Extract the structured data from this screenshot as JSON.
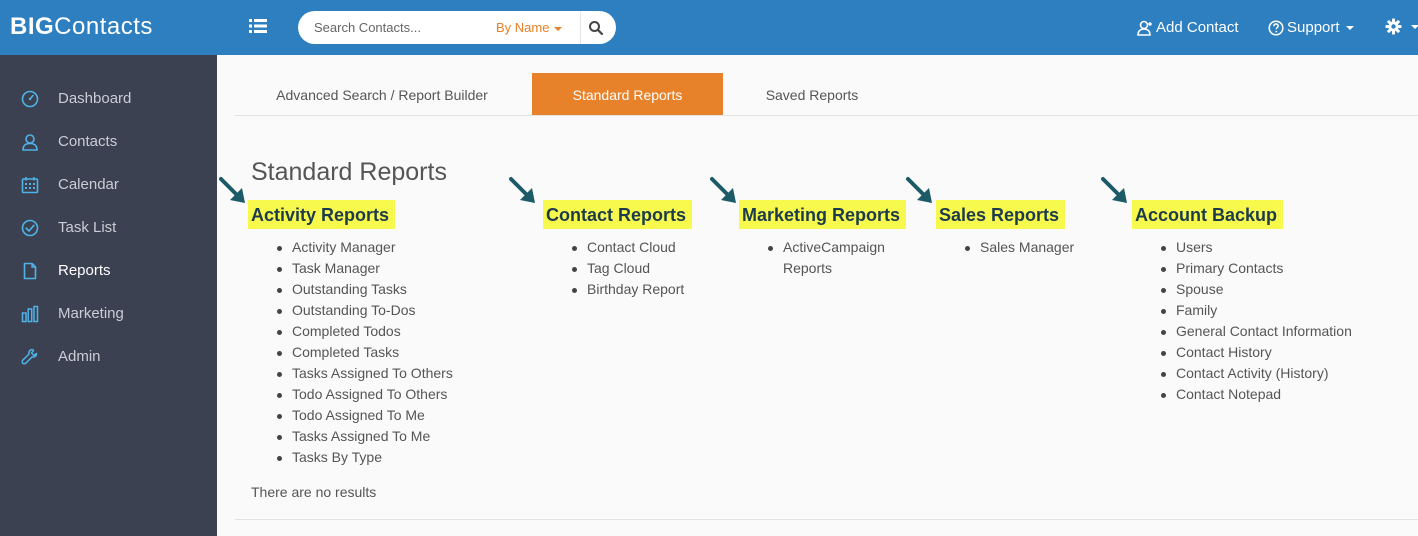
{
  "app": {
    "logo_big": "BIG",
    "logo_rest": "Contacts"
  },
  "search": {
    "placeholder": "Search Contacts...",
    "mode": "By Name"
  },
  "header": {
    "add_contact": "Add Contact",
    "support": "Support"
  },
  "sidebar": {
    "items": [
      {
        "label": "Dashboard",
        "icon": "dashboard-icon"
      },
      {
        "label": "Contacts",
        "icon": "user-icon"
      },
      {
        "label": "Calendar",
        "icon": "calendar-icon"
      },
      {
        "label": "Task List",
        "icon": "check-circle-icon"
      },
      {
        "label": "Reports",
        "icon": "file-icon"
      },
      {
        "label": "Marketing",
        "icon": "bar-chart-icon"
      },
      {
        "label": "Admin",
        "icon": "wrench-icon"
      }
    ],
    "active": "Reports"
  },
  "tabs": [
    {
      "label": "Advanced Search / Report Builder"
    },
    {
      "label": "Standard Reports"
    },
    {
      "label": "Saved Reports"
    }
  ],
  "main": {
    "title": "Standard Reports",
    "no_results": "There are no results",
    "columns": [
      {
        "header": "Activity Reports",
        "items": [
          "Activity Manager",
          "Task Manager",
          "Outstanding Tasks",
          "Outstanding To-Dos",
          "Completed Todos",
          "Completed Tasks",
          "Tasks Assigned To Others",
          "Todo Assigned To Others",
          "Todo Assigned To Me",
          "Tasks Assigned To Me",
          "Tasks By Type"
        ]
      },
      {
        "header": "Contact Reports",
        "items": [
          "Contact Cloud",
          "Tag Cloud",
          "Birthday Report"
        ]
      },
      {
        "header": "Marketing Reports",
        "items": [
          "ActiveCampaign",
          "Reports"
        ]
      },
      {
        "header": "Sales Reports",
        "items": [
          "Sales Manager"
        ]
      },
      {
        "header": "Account Backup",
        "items": [
          "Users",
          "Primary Contacts",
          "Spouse",
          "Family",
          "General Contact Information",
          "Contact History",
          "Contact Activity (History)",
          "Contact Notepad"
        ]
      }
    ]
  },
  "colors": {
    "topbar": "#2e7fc0",
    "sidebar": "#3b4151",
    "accent": "#e8822a",
    "highlight": "#f7f94d",
    "arrow": "#1b5a66"
  }
}
